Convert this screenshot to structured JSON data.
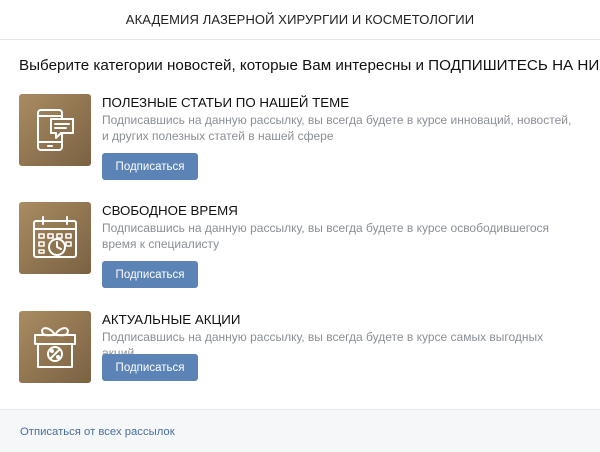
{
  "header": {
    "title": "АКАДЕМИЯ ЛАЗЕРНОЙ ХИРУРГИИ И КОСМЕТОЛОГИИ"
  },
  "intro": {
    "text": "Выберите категории новостей, которые Вам интересны и ПОДПИШИТЕСЬ НА НИХ!"
  },
  "categories": [
    {
      "icon": "smartphone-message-icon",
      "title": "ПОЛЕЗНЫЕ СТАТЬИ ПО НАШЕЙ ТЕМЕ",
      "description": "Подписавшись на данную рассылку, вы всегда будете в курсе инноваций, новостей, и других полезных статей в нашей сфере",
      "button_label": "Подписаться"
    },
    {
      "icon": "calendar-clock-icon",
      "title": "СВОБОДНОЕ ВРЕМЯ",
      "description": "Подписавшись на данную рассылку, вы всегда будете в курсе освободившегося время к специалисту",
      "button_label": "Подписаться"
    },
    {
      "icon": "gift-percent-icon",
      "title": "АКТУАЛЬНЫЕ АКЦИИ",
      "description": "Подписавшись на данную рассылку, вы всегда будете в курсе самых выгодных акций",
      "button_label": "Подписаться"
    }
  ],
  "footer": {
    "unsubscribe_label": "Отписаться от всех рассылок"
  },
  "colors": {
    "accent_button": "#5b83b5",
    "tile_gold": "#8f7450",
    "link": "#4a6f9e"
  }
}
